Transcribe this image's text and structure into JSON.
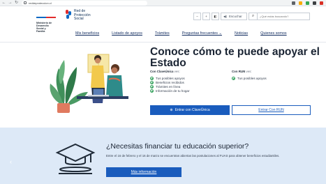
{
  "browser": {
    "url": "reddeproteccion.cl",
    "colors": {
      "tab_icon": "#f9ab00",
      "ext1": "#34a853",
      "ext2": "#d93025"
    }
  },
  "header": {
    "gov_logo_lines": [
      "Ministerio de",
      "Desarrollo",
      "Social y",
      "Familia"
    ],
    "brand_lines": [
      "Red de",
      "Protección",
      "Social"
    ],
    "tools": {
      "font_smaller": "−",
      "font_larger": "+",
      "contrast": "◧",
      "listen_label": "Escuchar"
    },
    "search_placeholder": "¿Qué estás buscando?",
    "nav": [
      {
        "label": "Mis beneficios"
      },
      {
        "label": "Listado de apoyos"
      },
      {
        "label": "Trámites"
      },
      {
        "label": "Preguntas frecuentes ⌄"
      },
      {
        "label": "Noticias"
      },
      {
        "label": "Quienes somos"
      }
    ]
  },
  "hero": {
    "title": "Conoce cómo te puede apoyar el Estado",
    "clave": {
      "heading": "Con ClaveÚnica",
      "heading_suffix": "ves:",
      "items": [
        "Tus posibles apoyos",
        "Beneficios recibidos",
        "Trámites en línea",
        "Información de tu hogar"
      ],
      "button": "Entrar con ClaveÚnica"
    },
    "run": {
      "heading": "Con RUN",
      "heading_suffix": "ves:",
      "items": [
        "Tus posibles apoyos"
      ],
      "button": "Entrar Con RUN"
    }
  },
  "banner": {
    "title": "¿Necesitas financiar tu educación superior?",
    "text": "Entre el 16 de febrero y el 16 de marzo se encuentran abiertas las postulaciones al FUAS para obtener beneficios estudiantiles.",
    "button": "Más información",
    "carousel_prev": "‹"
  }
}
